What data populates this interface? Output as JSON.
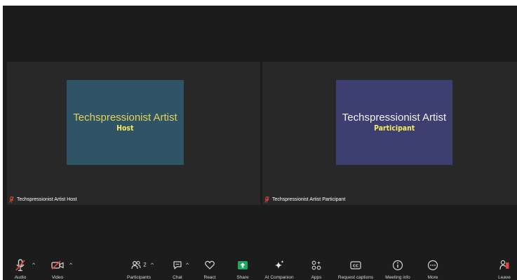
{
  "tiles": [
    {
      "card_name": "Techspressionist Artist",
      "card_role": "Host",
      "name_tag": "Techspressionist Artist Host"
    },
    {
      "card_name": "Techspressionist Artist",
      "card_role": "Participant",
      "name_tag": "Techspressionist Artist Participant"
    }
  ],
  "toolbar": {
    "audio": "Audio",
    "video": "Video",
    "participants": "Participants",
    "participants_count": "2",
    "chat": "Chat",
    "react": "React",
    "share": "Share",
    "ai_companion": "AI Companion",
    "apps": "Apps",
    "request_captions": "Request captions",
    "meeting_info": "Meeting info",
    "more": "More",
    "leave": "Leave"
  },
  "colors": {
    "background": "#1c1c1c",
    "tile": "#282828",
    "host_card": "#2f5466",
    "participant_card": "#3d3f70",
    "muted_red": "#e0443c",
    "share_green": "#1ba95d",
    "highlight_yellow": "#f5ec62"
  },
  "icons": [
    "mic-muted-icon",
    "video-off-icon",
    "participants-icon",
    "chat-icon",
    "react-heart-icon",
    "share-arrow-icon",
    "ai-sparkle-icon",
    "apps-icon",
    "captions-icon",
    "info-icon",
    "more-icon",
    "leave-icon"
  ]
}
